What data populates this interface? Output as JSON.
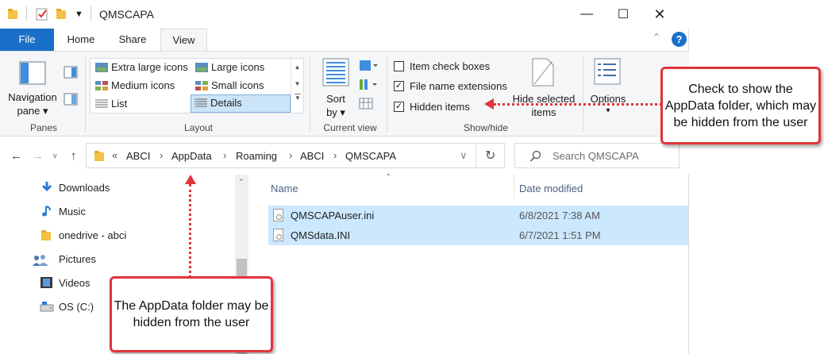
{
  "window": {
    "title": "QMSCAPA"
  },
  "tabs": {
    "file": "File",
    "home": "Home",
    "share": "Share",
    "view": "View"
  },
  "ribbon": {
    "panes": {
      "nav_label": "Navigation",
      "nav_label2": "pane",
      "group": "Panes"
    },
    "layout": {
      "items": [
        "Extra large icons",
        "Large icons",
        "Medium icons",
        "Small icons",
        "List",
        "Details"
      ],
      "selected": "Details",
      "group": "Layout"
    },
    "current_view": {
      "sort_label": "Sort",
      "sort_label2": "by",
      "group": "Current view"
    },
    "show_hide": {
      "item_check_boxes": "Item check boxes",
      "file_name_extensions": "File name extensions",
      "hidden_items": "Hidden items",
      "hide_selected": "Hide selected",
      "hide_selected2": "items",
      "group": "Show/hide"
    },
    "options": "Options"
  },
  "address": {
    "crumbs": [
      "ABCI",
      "AppData",
      "Roaming",
      "ABCI",
      "QMSCAPA"
    ],
    "search_placeholder": "Search QMSCAPA"
  },
  "nav_pane": {
    "items": [
      "Downloads",
      "Music",
      "onedrive - abci",
      "Pictures",
      "Videos",
      "OS (C:)"
    ]
  },
  "file_list": {
    "columns": {
      "name": "Name",
      "date": "Date modified"
    },
    "rows": [
      {
        "name": "QMSCAPAuser.ini",
        "date": "6/8/2021 7:38 AM"
      },
      {
        "name": "QMSdata.INI",
        "date": "6/7/2021 1:51 PM"
      }
    ]
  },
  "callouts": {
    "right": "Check to show the AppData folder, which may be hidden from the user",
    "bottom": "The AppData folder may be hidden from the user"
  },
  "colors": {
    "accent": "#1a6fc9",
    "selection": "#cce8ff",
    "callout_border": "#e0353b"
  }
}
